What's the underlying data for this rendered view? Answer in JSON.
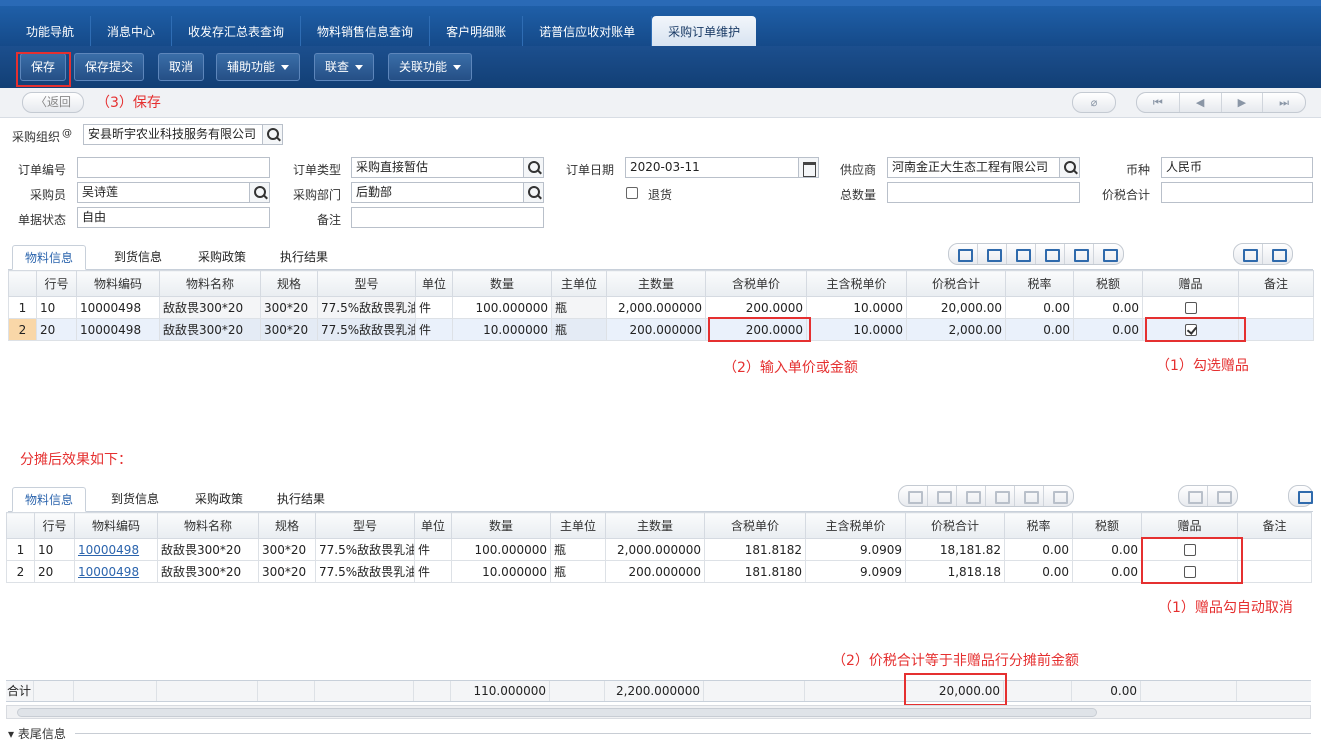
{
  "top_tabs": [
    "功能导航",
    "消息中心",
    "收发存汇总表查询",
    "物料销售信息查询",
    "客户明细账",
    "诺普信应收对账单",
    "采购订单维护"
  ],
  "toolbar": {
    "save": "保存",
    "save_submit": "保存提交",
    "cancel": "取消",
    "aux": "辅助功能",
    "query": "联查",
    "related": "关联功能"
  },
  "subbar": {
    "back": "〈返回"
  },
  "annotations": {
    "a_save": "（3）保存",
    "a_price": "（2）输入单价或金额",
    "a_gift": "（1）勾选赠品",
    "a_after": "分摊后效果如下：",
    "a_gift_auto": "（1）赠品勾自动取消",
    "a_total": "（2）价税合计等于非赠品行分摊前金额"
  },
  "form": {
    "org_label": "采购组织",
    "org_at": "@",
    "org_value": "安县昕宇农业科技服务有限公司",
    "order_no_label": "订单编号",
    "order_no_value": "",
    "order_type_label": "订单类型",
    "order_type_value": "采购直接暂估",
    "order_date_label": "订单日期",
    "order_date_value": "2020-03-11",
    "supplier_label": "供应商",
    "supplier_value": "河南金正大生态工程有限公司",
    "currency_label": "币种",
    "currency_value": "人民币",
    "buyer_label": "采购员",
    "buyer_value": "吴诗莲",
    "dept_label": "采购部门",
    "dept_value": "后勤部",
    "return_label": "退货",
    "total_qty_label": "总数量",
    "total_qty_value": "",
    "tax_total_label": "价税合计",
    "tax_total_value": "",
    "status_label": "单据状态",
    "status_value": "自由",
    "remark_label": "备注",
    "remark_value": ""
  },
  "section_tabs": [
    "物料信息",
    "到货信息",
    "采购政策",
    "执行结果"
  ],
  "columns": [
    "行号",
    "物料编码",
    "物料名称",
    "规格",
    "型号",
    "单位",
    "数量",
    "主单位",
    "主数量",
    "含税单价",
    "主含税单价",
    "价税合计",
    "税率",
    "税额",
    "赠品",
    "备注"
  ],
  "grid1": [
    {
      "idx": "1",
      "line": "10",
      "code": "10000498",
      "name": "敌敌畏300*20",
      "spec": "300*20",
      "model": "77.5%敌敌畏乳油",
      "unit": "件",
      "qty": "100.000000",
      "main_unit": "瓶",
      "main_qty": "2,000.000000",
      "price": "200.0000",
      "main_price": "10.0000",
      "total": "20,000.00",
      "tax_rate": "0.00",
      "tax": "0.00",
      "gift": false
    },
    {
      "idx": "2",
      "line": "20",
      "code": "10000498",
      "name": "敌敌畏300*20",
      "spec": "300*20",
      "model": "77.5%敌敌畏乳油",
      "unit": "件",
      "qty": "10.000000",
      "main_unit": "瓶",
      "main_qty": "200.000000",
      "price": "200.0000",
      "main_price": "10.0000",
      "total": "2,000.00",
      "tax_rate": "0.00",
      "tax": "0.00",
      "gift": true
    }
  ],
  "grid2": [
    {
      "idx": "1",
      "line": "10",
      "code": "10000498",
      "name": "敌敌畏300*20",
      "spec": "300*20",
      "model": "77.5%敌敌畏乳油",
      "unit": "件",
      "qty": "100.000000",
      "main_unit": "瓶",
      "main_qty": "2,000.000000",
      "price": "181.8182",
      "main_price": "9.0909",
      "total": "18,181.82",
      "tax_rate": "0.00",
      "tax": "0.00",
      "gift": false
    },
    {
      "idx": "2",
      "line": "20",
      "code": "10000498",
      "name": "敌敌畏300*20",
      "spec": "300*20",
      "model": "77.5%敌敌畏乳油",
      "unit": "件",
      "qty": "10.000000",
      "main_unit": "瓶",
      "main_qty": "200.000000",
      "price": "181.8180",
      "main_price": "9.0909",
      "total": "1,818.18",
      "tax_rate": "0.00",
      "tax": "0.00",
      "gift": false
    }
  ],
  "totals": {
    "label": "合计",
    "qty": "110.000000",
    "main_qty": "2,200.000000",
    "total": "20,000.00",
    "tax": "0.00"
  },
  "footer": {
    "section": "表尾信息"
  },
  "colors": {
    "accent": "#1f5fa8",
    "annotation": "#e53030",
    "link": "#2b64ad"
  }
}
